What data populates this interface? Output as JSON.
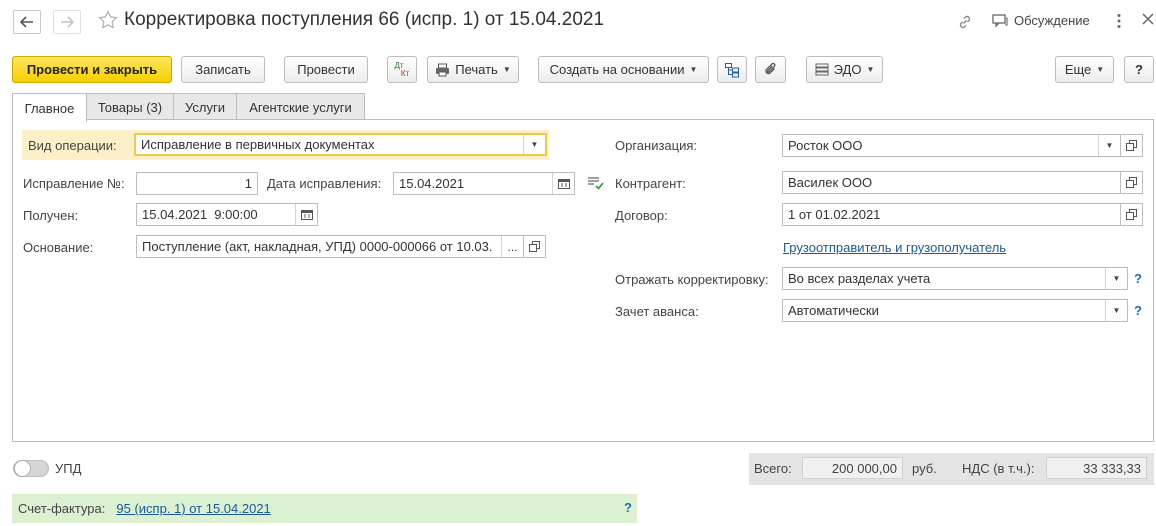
{
  "window": {
    "title": "Корректировка поступления 66 (испр. 1) от 15.04.2021",
    "discuss_label": "Обсуждение",
    "icons": [
      "arrow-left-icon",
      "arrow-right-icon",
      "star-icon",
      "link-icon",
      "discussion-icon",
      "more-vert-icon",
      "close-icon"
    ]
  },
  "toolbar": {
    "post_close": "Провести и закрыть",
    "save": "Записать",
    "post": "Провести",
    "dt_kt_top": "Дт",
    "dt_kt_bottom": "Кт",
    "print": "Печать",
    "create_based": "Создать на основании",
    "edo": "ЭДО",
    "more": "Еще",
    "help": "?"
  },
  "tabs": [
    "Главное",
    "Товары (3)",
    "Услуги",
    "Агентские услуги"
  ],
  "left": {
    "op_label": "Вид операции:",
    "op_value": "Исправление в первичных документах",
    "fix_no_label": "Исправление №:",
    "fix_no_value": "1",
    "fix_date_label": "Дата исправления:",
    "fix_date_value": "15.04.2021",
    "received_label": "Получен:",
    "received_value": "15.04.2021  9:00:00",
    "basis_label": "Основание:",
    "basis_value": "Поступление (акт, накладная, УПД) 0000-000066 от 10.03.",
    "basis_btn": "..."
  },
  "right": {
    "org_label": "Организация:",
    "org_value": "Росток ООО",
    "counterparty_label": "Контрагент:",
    "counterparty_value": "Василек ООО",
    "contract_label": "Договор:",
    "contract_value": "1 от 01.02.2021",
    "shipper_link": "Грузоотправитель и грузополучатель",
    "reflect_label": "Отражать корректировку:",
    "reflect_value": "Во всех разделах учета",
    "advance_label": "Зачет аванса:",
    "advance_value": "Автоматически",
    "help": "?"
  },
  "footer": {
    "upd_label": "УПД",
    "upd_on": false,
    "total_label": "Всего:",
    "total_value": "200 000,00",
    "currency": "руб.",
    "vat_label": "НДС (в т.ч.):",
    "vat_value": "33 333,33",
    "invoice_label": "Счет-фактура:",
    "invoice_link": "95 (испр. 1) от 15.04.2021",
    "invoice_help": "?"
  },
  "colors": {
    "primary_button": "#f5d000",
    "highlight_field": "#fdf0c8",
    "invoice_bar": "#dcf0d2",
    "link": "#1a5a96",
    "help": "#1a6fb5"
  }
}
